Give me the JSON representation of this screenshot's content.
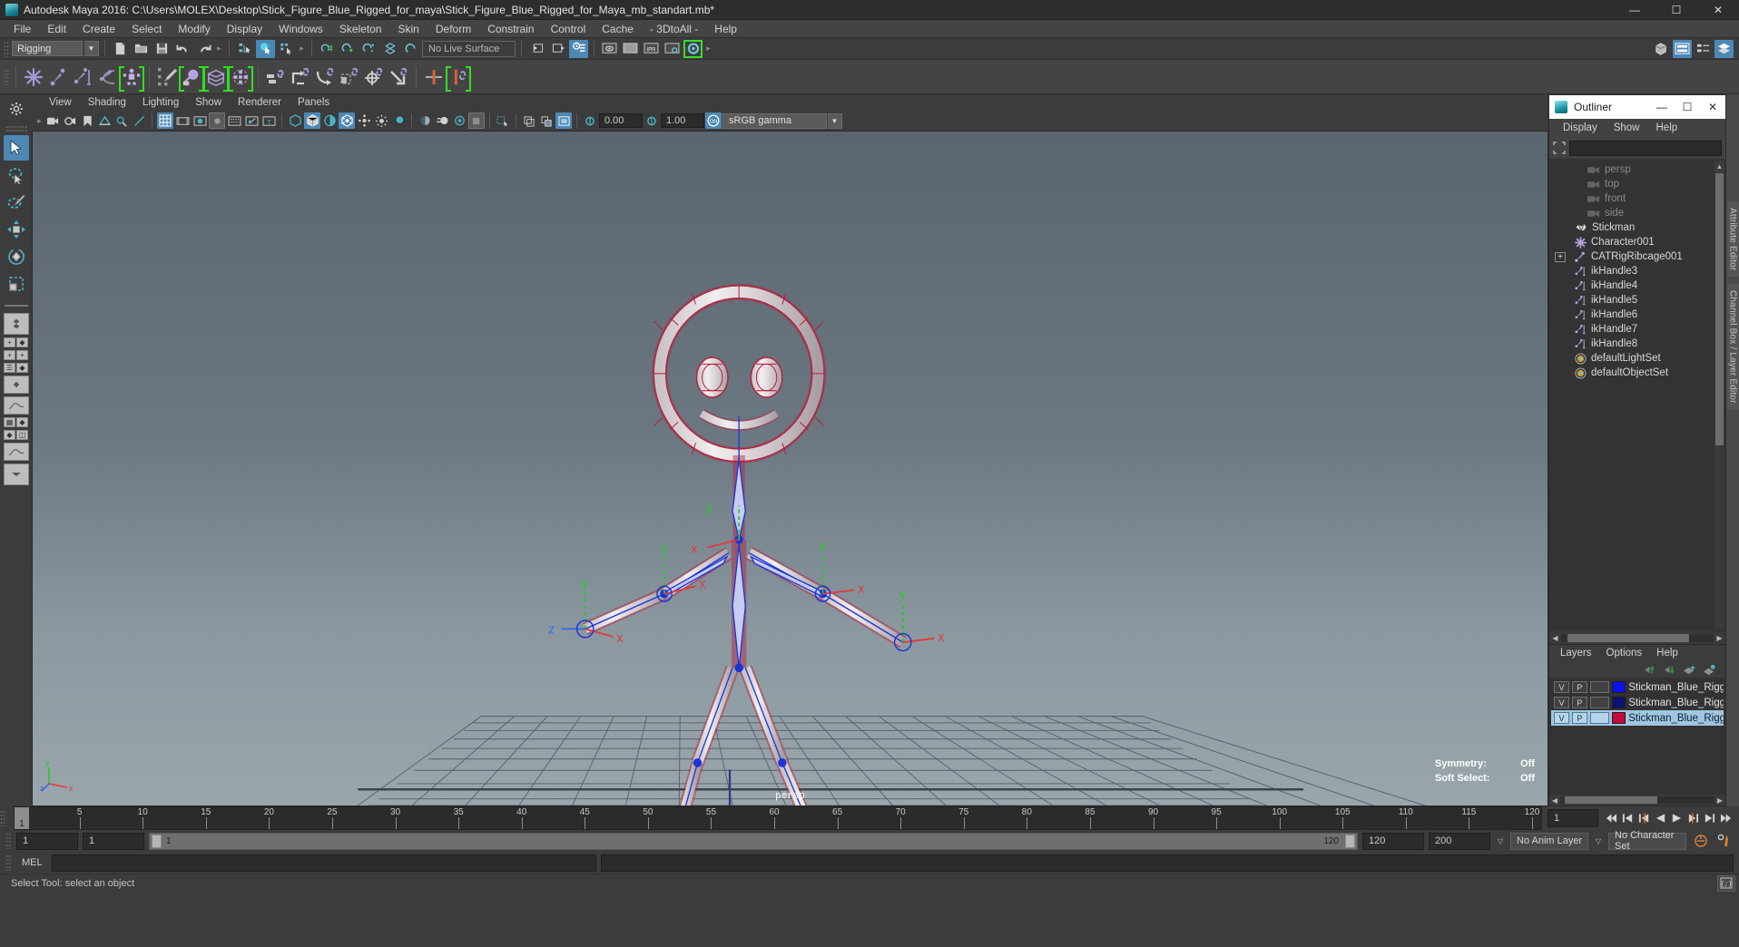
{
  "window": {
    "title": "Autodesk Maya 2016: C:\\Users\\MOLEX\\Desktop\\Stick_Figure_Blue_Rigged_for_maya\\Stick_Figure_Blue_Rigged_for_Maya_mb_standart.mb*",
    "minimize": "—",
    "maximize": "☐",
    "close": "✕"
  },
  "menubar": {
    "items": [
      "File",
      "Edit",
      "Create",
      "Select",
      "Modify",
      "Display",
      "Windows",
      "Skeleton",
      "Skin",
      "Deform",
      "Constrain",
      "Control",
      "Cache",
      "- 3DtoAll -",
      "Help"
    ]
  },
  "statusline": {
    "menuset": "Rigging",
    "menuset_arrow": "▼",
    "live_surface": "No Live Surface"
  },
  "viewport_menu": {
    "items": [
      "View",
      "Shading",
      "Lighting",
      "Show",
      "Renderer",
      "Panels"
    ]
  },
  "viewport_tools": {
    "exposure_value": "0.00",
    "gamma_value": "1.00",
    "color_space": "sRGB gamma",
    "color_space_arrow": "▼",
    "view_toggle_label": "ON"
  },
  "viewport": {
    "camera_label": "persp",
    "hud": [
      {
        "label": "Symmetry:",
        "value": "Off"
      },
      {
        "label": "Soft Select:",
        "value": "Off"
      }
    ],
    "axis_labels": {
      "x": "x",
      "y": "y",
      "z": "z"
    },
    "manipulator_axis_colors": {
      "x": "#e03a3a",
      "y": "#3ae03a",
      "z": "#3a6ae0"
    },
    "mesh_wire_color": "#b5203c",
    "skeleton_color": "#1b35d8",
    "background_top": "#5b6671",
    "background_bottom": "#9aa6ab"
  },
  "outliner": {
    "title": "Outliner",
    "menu": [
      "Display",
      "Show",
      "Help"
    ],
    "items": [
      {
        "label": "persp",
        "icon": "camera-icon",
        "dim": true,
        "indent": 0,
        "expandable": false
      },
      {
        "label": "top",
        "icon": "camera-icon",
        "dim": true,
        "indent": 0,
        "expandable": false
      },
      {
        "label": "front",
        "icon": "camera-icon",
        "dim": true,
        "indent": 0,
        "expandable": false
      },
      {
        "label": "side",
        "icon": "camera-icon",
        "dim": true,
        "indent": 0,
        "expandable": false
      },
      {
        "label": "Stickman",
        "icon": "mesh-icon",
        "dim": false,
        "indent": 0,
        "expandable": false
      },
      {
        "label": "Character001",
        "icon": "asterisk-icon",
        "dim": false,
        "indent": 0,
        "expandable": false
      },
      {
        "label": "CATRigRibcage001",
        "icon": "joint-icon",
        "dim": false,
        "indent": 0,
        "expandable": true
      },
      {
        "label": "ikHandle3",
        "icon": "ikhandle-icon",
        "dim": false,
        "indent": 0,
        "expandable": false
      },
      {
        "label": "ikHandle4",
        "icon": "ikhandle-icon",
        "dim": false,
        "indent": 0,
        "expandable": false
      },
      {
        "label": "ikHandle5",
        "icon": "ikhandle-icon",
        "dim": false,
        "indent": 0,
        "expandable": false
      },
      {
        "label": "ikHandle6",
        "icon": "ikhandle-icon",
        "dim": false,
        "indent": 0,
        "expandable": false
      },
      {
        "label": "ikHandle7",
        "icon": "ikhandle-icon",
        "dim": false,
        "indent": 0,
        "expandable": false
      },
      {
        "label": "ikHandle8",
        "icon": "ikhandle-icon",
        "dim": false,
        "indent": 0,
        "expandable": false
      },
      {
        "label": "defaultLightSet",
        "icon": "set-icon",
        "dim": false,
        "indent": 0,
        "expandable": false
      },
      {
        "label": "defaultObjectSet",
        "icon": "set-icon",
        "dim": false,
        "indent": 0,
        "expandable": false
      }
    ],
    "expand_glyph": "+"
  },
  "layers": {
    "menu": [
      "Layers",
      "Options",
      "Help"
    ],
    "columns": [
      "V",
      "P"
    ],
    "rows": [
      {
        "v": "V",
        "p": "P",
        "color": "#0b12ee",
        "name": "Stickman_Blue_Rigged",
        "selected": false
      },
      {
        "v": "V",
        "p": "P",
        "color": "#0b1470",
        "name": "Stickman_Blue_Rigged",
        "selected": false
      },
      {
        "v": "V",
        "p": "P",
        "color": "#c2083c",
        "name": "Stickman_Blue_Rigged",
        "selected": true
      }
    ]
  },
  "side_tabs": [
    "Attribute Editor",
    "Channel Box / Layer Editor"
  ],
  "timeline": {
    "ticks": [
      5,
      10,
      15,
      20,
      25,
      30,
      35,
      40,
      45,
      50,
      55,
      60,
      65,
      70,
      75,
      80,
      85,
      90,
      95,
      100,
      105,
      110,
      115,
      120
    ],
    "start": 1,
    "end": 120,
    "current_frame": "1",
    "current_frame_marker": "1",
    "playback_buttons": [
      "⏮",
      "⏪",
      "◀|",
      "◀",
      "▶",
      "|▶",
      "⏩",
      "⏭"
    ]
  },
  "range": {
    "anim_start": "1",
    "anim_end": "1",
    "range_start_label": "1",
    "range_end_label": "120",
    "playback_end": "120",
    "anim_total_end": "200",
    "anim_layer": "No Anim Layer",
    "character_set": "No Character Set",
    "dropdown_arrow": "▽"
  },
  "mel": {
    "label": "MEL",
    "input_value": "",
    "output_value": ""
  },
  "helpline": {
    "text": "Select Tool: select an object"
  }
}
